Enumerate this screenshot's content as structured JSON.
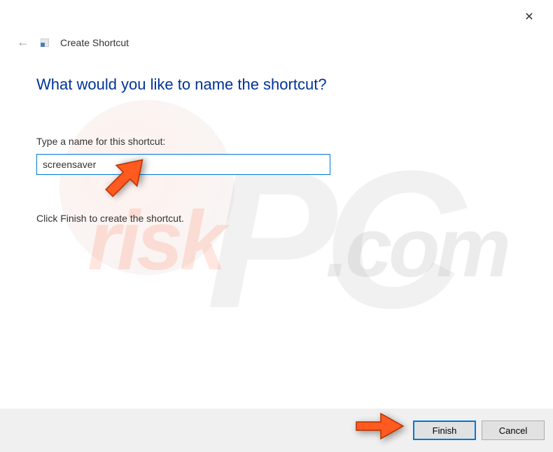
{
  "header": {
    "title": "Create Shortcut"
  },
  "content": {
    "heading": "What would you like to name the shortcut?",
    "input_label": "Type a name for this shortcut:",
    "input_value": "screensaver",
    "instruction": "Click Finish to create the shortcut."
  },
  "buttons": {
    "finish": "Finish",
    "cancel": "Cancel"
  }
}
